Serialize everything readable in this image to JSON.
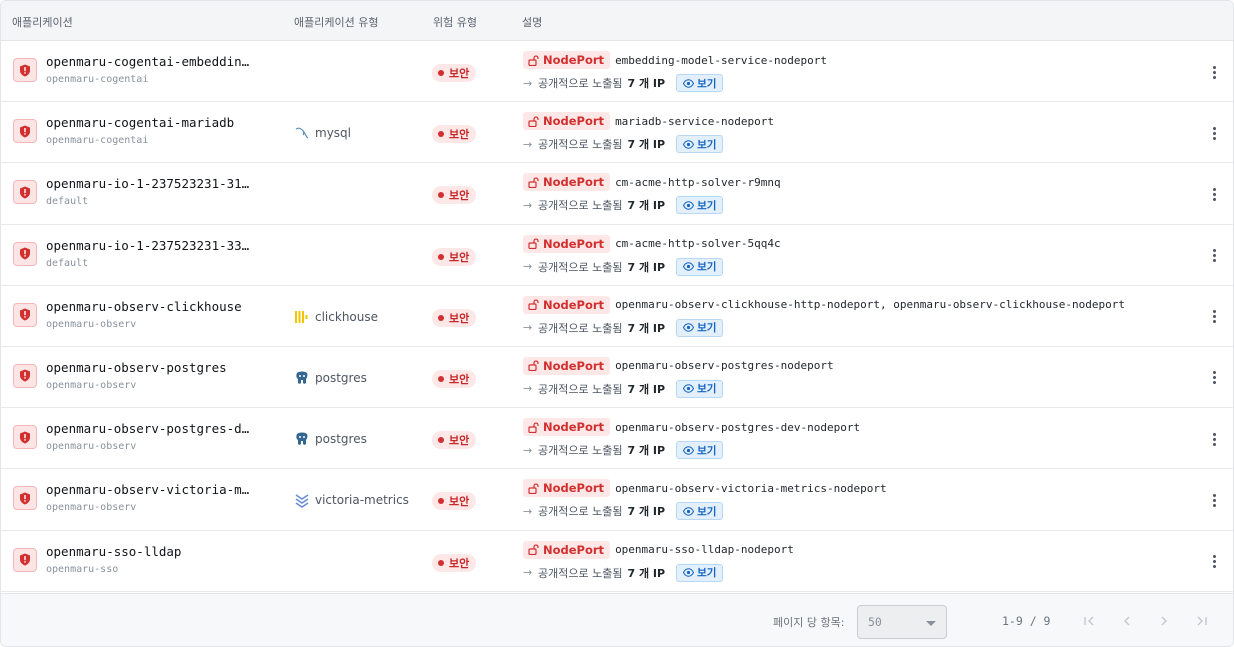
{
  "table": {
    "headers": {
      "application": "애플리케이션",
      "app_type": "애플리케이션 유형",
      "risk_type": "위험 유형",
      "description": "설명"
    },
    "rows": [
      {
        "name": "openmaru-cogentai-embeddin…",
        "namespace": "openmaru-cogentai",
        "type": "",
        "type_icon": "",
        "risk": "보안",
        "badge": "NodePort",
        "service": "embedding-model-service-nodeport",
        "exposed": "공개적으로 노출됨",
        "ip_count": "7 개 IP",
        "view": "보기"
      },
      {
        "name": "openmaru-cogentai-mariadb",
        "namespace": "openmaru-cogentai",
        "type": "mysql",
        "type_icon": "mysql-icon",
        "risk": "보안",
        "badge": "NodePort",
        "service": "mariadb-service-nodeport",
        "exposed": "공개적으로 노출됨",
        "ip_count": "7 개 IP",
        "view": "보기"
      },
      {
        "name": "openmaru-io-1-237523231-31…",
        "namespace": "default",
        "type": "",
        "type_icon": "",
        "risk": "보안",
        "badge": "NodePort",
        "service": "cm-acme-http-solver-r9mnq",
        "exposed": "공개적으로 노출됨",
        "ip_count": "7 개 IP",
        "view": "보기"
      },
      {
        "name": "openmaru-io-1-237523231-33…",
        "namespace": "default",
        "type": "",
        "type_icon": "",
        "risk": "보안",
        "badge": "NodePort",
        "service": "cm-acme-http-solver-5qq4c",
        "exposed": "공개적으로 노출됨",
        "ip_count": "7 개 IP",
        "view": "보기"
      },
      {
        "name": "openmaru-observ-clickhouse",
        "namespace": "openmaru-observ",
        "type": "clickhouse",
        "type_icon": "clickhouse-icon",
        "risk": "보안",
        "badge": "NodePort",
        "service": "openmaru-observ-clickhouse-http-nodeport, openmaru-observ-clickhouse-nodeport",
        "exposed": "공개적으로 노출됨",
        "ip_count": "7 개 IP",
        "view": "보기"
      },
      {
        "name": "openmaru-observ-postgres",
        "namespace": "openmaru-observ",
        "type": "postgres",
        "type_icon": "postgres-icon",
        "risk": "보안",
        "badge": "NodePort",
        "service": "openmaru-observ-postgres-nodeport",
        "exposed": "공개적으로 노출됨",
        "ip_count": "7 개 IP",
        "view": "보기"
      },
      {
        "name": "openmaru-observ-postgres-dev",
        "namespace": "openmaru-observ",
        "type": "postgres",
        "type_icon": "postgres-icon",
        "risk": "보안",
        "badge": "NodePort",
        "service": "openmaru-observ-postgres-dev-nodeport",
        "exposed": "공개적으로 노출됨",
        "ip_count": "7 개 IP",
        "view": "보기"
      },
      {
        "name": "openmaru-observ-victoria-m…",
        "namespace": "openmaru-observ",
        "type": "victoria-metrics",
        "type_icon": "victoria-metrics-icon",
        "risk": "보안",
        "badge": "NodePort",
        "service": "openmaru-observ-victoria-metrics-nodeport",
        "exposed": "공개적으로 노출됨",
        "ip_count": "7 개 IP",
        "view": "보기"
      },
      {
        "name": "openmaru-sso-lldap",
        "namespace": "openmaru-sso",
        "type": "",
        "type_icon": "",
        "risk": "보안",
        "badge": "NodePort",
        "service": "openmaru-sso-lldap-nodeport",
        "exposed": "공개적으로 노출됨",
        "ip_count": "7 개 IP",
        "view": "보기"
      }
    ]
  },
  "pagination": {
    "per_page_label": "페이지 당 항목:",
    "per_page_value": "50",
    "range": "1-9 / 9"
  },
  "colors": {
    "danger": "#d32f2f",
    "danger_bg": "#fde7e7",
    "info": "#1565c0",
    "info_bg": "#e3f0fc"
  }
}
